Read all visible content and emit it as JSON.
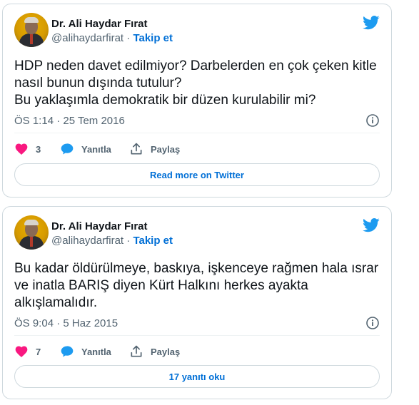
{
  "colors": {
    "accent": "#1d9bf0",
    "link": "#006fd6",
    "like": "#f91880",
    "muted": "#536471",
    "border": "#cfd9de"
  },
  "tweets": [
    {
      "author_name": "Dr. Ali Haydar Fırat",
      "handle": "@alihaydarfirat",
      "separator": "·",
      "follow_label": "Takip et",
      "text": "HDP neden davet edilmiyor? Darbelerden en çok çeken kitle nasıl bunun dışında tutulur?\nBu yaklaşımla demokratik bir düzen kurulabilir mi?",
      "timestamp": "ÖS 1:14 · 25 Tem 2016",
      "likes": "3",
      "reply_label": "Yanıtla",
      "share_label": "Paylaş",
      "cta_label": "Read more on Twitter",
      "icons": [
        "avatar",
        "twitter-bird-icon",
        "info-icon",
        "heart-icon",
        "reply-bubble-icon",
        "share-icon"
      ]
    },
    {
      "author_name": "Dr. Ali Haydar Fırat",
      "handle": "@alihaydarfirat",
      "separator": "·",
      "follow_label": "Takip et",
      "text": "Bu kadar öldürülmeye, baskıya, işkenceye rağmen hala ısrar ve inatla BARIŞ diyen Kürt Halkını herkes ayakta alkışlamalıdır.",
      "timestamp": "ÖS 9:04 · 5 Haz 2015",
      "likes": "7",
      "reply_label": "Yanıtla",
      "share_label": "Paylaş",
      "cta_label": "17 yanıtı oku",
      "icons": [
        "avatar",
        "twitter-bird-icon",
        "info-icon",
        "heart-icon",
        "reply-bubble-icon",
        "share-icon"
      ]
    }
  ]
}
